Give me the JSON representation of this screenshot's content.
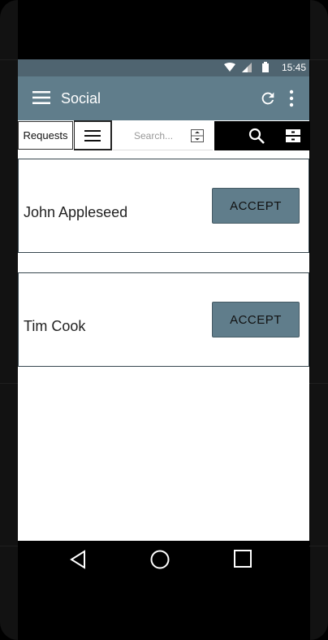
{
  "status_bar": {
    "time": "15:45"
  },
  "app_bar": {
    "title": "Social"
  },
  "toolbar": {
    "requests_tab": "Requests",
    "search_placeholder": "Search..."
  },
  "requests": [
    {
      "name": "John Appleseed",
      "accept_label": "ACCEPT"
    },
    {
      "name": "Tim Cook",
      "accept_label": "ACCEPT"
    }
  ],
  "colors": {
    "app_bar": "#607d8b",
    "status_bar": "#4f6470",
    "accept_button": "#607d8b"
  },
  "icons": [
    "wifi-icon",
    "signal-icon",
    "battery-icon",
    "menu-icon",
    "refresh-icon",
    "more-vert-icon",
    "list-icon",
    "search-icon",
    "filter-icon",
    "back-icon",
    "home-icon",
    "recents-icon"
  ]
}
